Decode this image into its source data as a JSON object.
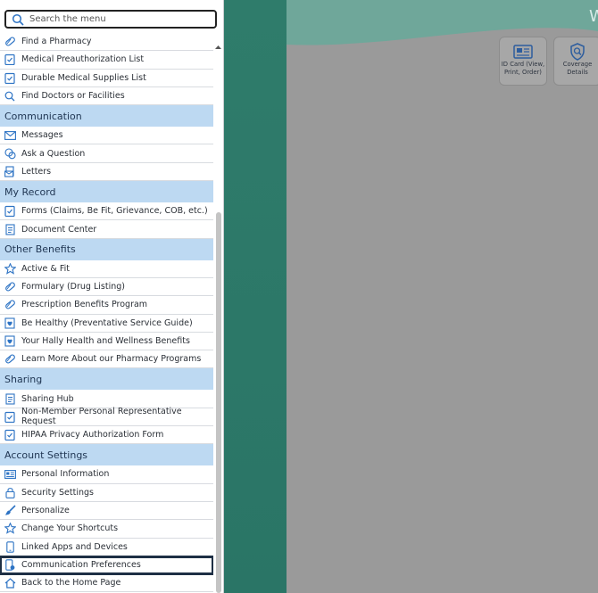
{
  "search": {
    "placeholder": "Search the menu"
  },
  "items": {
    "find_pharmacy": "Find a Pharmacy",
    "med_preauth": "Medical Preauthorization List",
    "dme_list": "Durable Medical Supplies List",
    "find_doctors": "Find Doctors or Facilities",
    "communication": "Communication",
    "messages": "Messages",
    "ask_question": "Ask a Question",
    "letters": "Letters",
    "my_record": "My Record",
    "forms": "Forms (Claims, Be Fit, Grievance, COB, etc.)",
    "document_center": "Document Center",
    "other_benefits": "Other Benefits",
    "active_fit": "Active & Fit",
    "formulary": "Formulary (Drug Listing)",
    "rx_program": "Prescription Benefits Program",
    "be_healthy": "Be Healthy (Preventative Service Guide)",
    "hally": "Your Hally Health and Wellness Benefits",
    "learn_pharmacy": "Learn More About our Pharmacy Programs",
    "sharing": "Sharing",
    "sharing_hub": "Sharing Hub",
    "non_member": "Non-Member Personal Representative Request",
    "hipaa": "HIPAA Privacy Authorization Form",
    "account_settings": "Account Settings",
    "personal_info": "Personal Information",
    "security": "Security Settings",
    "personalize": "Personalize",
    "shortcuts": "Change Your Shortcuts",
    "linked_apps": "Linked Apps and Devices",
    "comm_prefs": "Communication Preferences",
    "back_home": "Back to the Home Page"
  },
  "background": {
    "welcome_partial": "W",
    "id_card_line1": "ID Card (View,",
    "id_card_line2": "Print, Order)",
    "coverage_line1": "Coverage",
    "coverage_line2": "Details"
  },
  "colors": {
    "header_bg": "#bdd9f2",
    "icon_blue": "#2d73c4",
    "teal": "#2f7c6b",
    "overlay": "#9a9a9a"
  }
}
